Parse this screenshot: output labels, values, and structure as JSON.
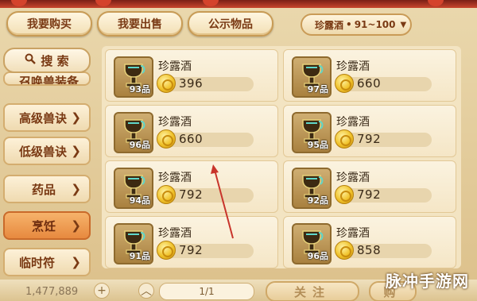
{
  "tabs": [
    {
      "label": "我要购买"
    },
    {
      "label": "我要出售"
    },
    {
      "label": "公示物品"
    }
  ],
  "filter": {
    "item": "珍露酒",
    "separator": "•",
    "range": "91~100"
  },
  "left_nav": {
    "search_label": "搜 索",
    "clipped_item": "召唤兽装备",
    "items": [
      {
        "label": "高级兽诀"
      },
      {
        "label": "低级兽诀"
      },
      {
        "label": "药品"
      },
      {
        "label": "烹饪"
      },
      {
        "label": "临时符"
      }
    ]
  },
  "listings": [
    {
      "name": "珍露酒",
      "grade": "93品",
      "price": "396"
    },
    {
      "name": "珍露酒",
      "grade": "97品",
      "price": "660"
    },
    {
      "name": "珍露酒",
      "grade": "96品",
      "price": "660"
    },
    {
      "name": "珍露酒",
      "grade": "95品",
      "price": "792"
    },
    {
      "name": "珍露酒",
      "grade": "94品",
      "price": "792"
    },
    {
      "name": "珍露酒",
      "grade": "92品",
      "price": "792"
    },
    {
      "name": "珍露酒",
      "grade": "91品",
      "price": "792"
    },
    {
      "name": "珍露酒",
      "grade": "96品",
      "price": "858"
    }
  ],
  "bottom": {
    "money": "1,477,889",
    "add_label": "+",
    "page": "1/1",
    "follow_label": "关注",
    "buy_label": "购"
  },
  "watermark": "脉冲手游网"
}
